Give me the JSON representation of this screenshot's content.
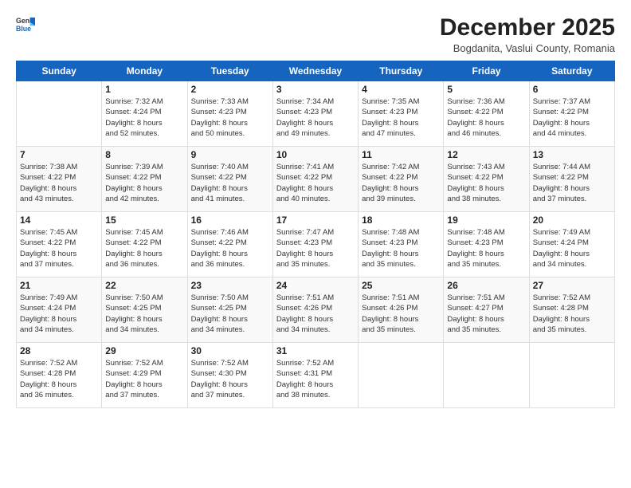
{
  "logo": {
    "general": "General",
    "blue": "Blue"
  },
  "title": "December 2025",
  "subtitle": "Bogdanita, Vaslui County, Romania",
  "days_of_week": [
    "Sunday",
    "Monday",
    "Tuesday",
    "Wednesday",
    "Thursday",
    "Friday",
    "Saturday"
  ],
  "weeks": [
    [
      {
        "day": "",
        "info": ""
      },
      {
        "day": "1",
        "info": "Sunrise: 7:32 AM\nSunset: 4:24 PM\nDaylight: 8 hours\nand 52 minutes."
      },
      {
        "day": "2",
        "info": "Sunrise: 7:33 AM\nSunset: 4:23 PM\nDaylight: 8 hours\nand 50 minutes."
      },
      {
        "day": "3",
        "info": "Sunrise: 7:34 AM\nSunset: 4:23 PM\nDaylight: 8 hours\nand 49 minutes."
      },
      {
        "day": "4",
        "info": "Sunrise: 7:35 AM\nSunset: 4:23 PM\nDaylight: 8 hours\nand 47 minutes."
      },
      {
        "day": "5",
        "info": "Sunrise: 7:36 AM\nSunset: 4:22 PM\nDaylight: 8 hours\nand 46 minutes."
      },
      {
        "day": "6",
        "info": "Sunrise: 7:37 AM\nSunset: 4:22 PM\nDaylight: 8 hours\nand 44 minutes."
      }
    ],
    [
      {
        "day": "7",
        "info": "Sunrise: 7:38 AM\nSunset: 4:22 PM\nDaylight: 8 hours\nand 43 minutes."
      },
      {
        "day": "8",
        "info": "Sunrise: 7:39 AM\nSunset: 4:22 PM\nDaylight: 8 hours\nand 42 minutes."
      },
      {
        "day": "9",
        "info": "Sunrise: 7:40 AM\nSunset: 4:22 PM\nDaylight: 8 hours\nand 41 minutes."
      },
      {
        "day": "10",
        "info": "Sunrise: 7:41 AM\nSunset: 4:22 PM\nDaylight: 8 hours\nand 40 minutes."
      },
      {
        "day": "11",
        "info": "Sunrise: 7:42 AM\nSunset: 4:22 PM\nDaylight: 8 hours\nand 39 minutes."
      },
      {
        "day": "12",
        "info": "Sunrise: 7:43 AM\nSunset: 4:22 PM\nDaylight: 8 hours\nand 38 minutes."
      },
      {
        "day": "13",
        "info": "Sunrise: 7:44 AM\nSunset: 4:22 PM\nDaylight: 8 hours\nand 37 minutes."
      }
    ],
    [
      {
        "day": "14",
        "info": "Sunrise: 7:45 AM\nSunset: 4:22 PM\nDaylight: 8 hours\nand 37 minutes."
      },
      {
        "day": "15",
        "info": "Sunrise: 7:45 AM\nSunset: 4:22 PM\nDaylight: 8 hours\nand 36 minutes."
      },
      {
        "day": "16",
        "info": "Sunrise: 7:46 AM\nSunset: 4:22 PM\nDaylight: 8 hours\nand 36 minutes."
      },
      {
        "day": "17",
        "info": "Sunrise: 7:47 AM\nSunset: 4:23 PM\nDaylight: 8 hours\nand 35 minutes."
      },
      {
        "day": "18",
        "info": "Sunrise: 7:48 AM\nSunset: 4:23 PM\nDaylight: 8 hours\nand 35 minutes."
      },
      {
        "day": "19",
        "info": "Sunrise: 7:48 AM\nSunset: 4:23 PM\nDaylight: 8 hours\nand 35 minutes."
      },
      {
        "day": "20",
        "info": "Sunrise: 7:49 AM\nSunset: 4:24 PM\nDaylight: 8 hours\nand 34 minutes."
      }
    ],
    [
      {
        "day": "21",
        "info": "Sunrise: 7:49 AM\nSunset: 4:24 PM\nDaylight: 8 hours\nand 34 minutes."
      },
      {
        "day": "22",
        "info": "Sunrise: 7:50 AM\nSunset: 4:25 PM\nDaylight: 8 hours\nand 34 minutes."
      },
      {
        "day": "23",
        "info": "Sunrise: 7:50 AM\nSunset: 4:25 PM\nDaylight: 8 hours\nand 34 minutes."
      },
      {
        "day": "24",
        "info": "Sunrise: 7:51 AM\nSunset: 4:26 PM\nDaylight: 8 hours\nand 34 minutes."
      },
      {
        "day": "25",
        "info": "Sunrise: 7:51 AM\nSunset: 4:26 PM\nDaylight: 8 hours\nand 35 minutes."
      },
      {
        "day": "26",
        "info": "Sunrise: 7:51 AM\nSunset: 4:27 PM\nDaylight: 8 hours\nand 35 minutes."
      },
      {
        "day": "27",
        "info": "Sunrise: 7:52 AM\nSunset: 4:28 PM\nDaylight: 8 hours\nand 35 minutes."
      }
    ],
    [
      {
        "day": "28",
        "info": "Sunrise: 7:52 AM\nSunset: 4:28 PM\nDaylight: 8 hours\nand 36 minutes."
      },
      {
        "day": "29",
        "info": "Sunrise: 7:52 AM\nSunset: 4:29 PM\nDaylight: 8 hours\nand 37 minutes."
      },
      {
        "day": "30",
        "info": "Sunrise: 7:52 AM\nSunset: 4:30 PM\nDaylight: 8 hours\nand 37 minutes."
      },
      {
        "day": "31",
        "info": "Sunrise: 7:52 AM\nSunset: 4:31 PM\nDaylight: 8 hours\nand 38 minutes."
      },
      {
        "day": "",
        "info": ""
      },
      {
        "day": "",
        "info": ""
      },
      {
        "day": "",
        "info": ""
      }
    ]
  ]
}
